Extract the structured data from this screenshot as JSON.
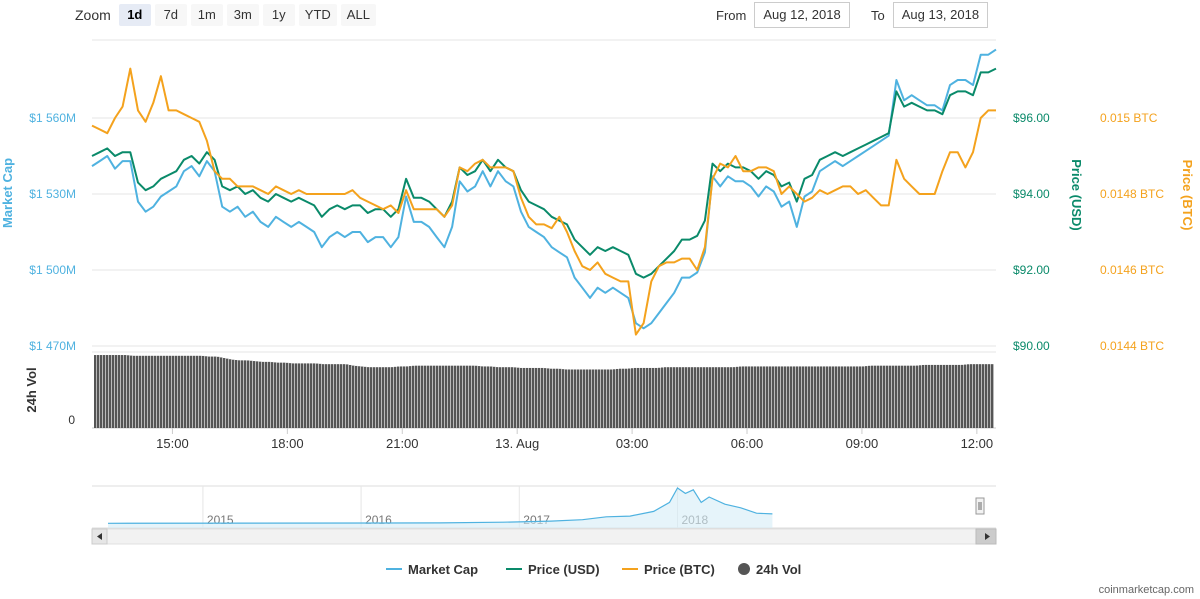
{
  "zoom": {
    "label": "Zoom",
    "buttons": [
      "1d",
      "7d",
      "1m",
      "3m",
      "1y",
      "YTD",
      "ALL"
    ],
    "active": "1d"
  },
  "range": {
    "from_label": "From",
    "from_value": "Aug 12, 2018",
    "to_label": "To",
    "to_value": "Aug 13, 2018"
  },
  "footer": {
    "credit": "coinmarketcap.com"
  },
  "colors": {
    "market_cap": "#4fb2e0",
    "price_usd": "#0a8a6a",
    "price_btc": "#f4a21d",
    "volume": "#555555",
    "grid": "#e6e6e6"
  },
  "chart_data": {
    "type": "line",
    "axes": {
      "left": {
        "title": "Market Cap",
        "ticks": [
          "$1 470M",
          "$1 500M",
          "$1 530M",
          "$1 560M"
        ],
        "range": [
          1470,
          1560
        ],
        "unit": "M USD"
      },
      "right_usd": {
        "title": "Price (USD)",
        "ticks": [
          "$90.00",
          "$92.00",
          "$94.00",
          "$96.00"
        ],
        "range": [
          90,
          96
        ]
      },
      "right_btc": {
        "title": "Price (BTC)",
        "ticks": [
          "0.0144 BTC",
          "0.0146 BTC",
          "0.0148 BTC",
          "0.015 BTC"
        ],
        "range": [
          0.0144,
          0.015
        ]
      },
      "volume": {
        "title": "24h Vol",
        "ticks": [
          "0"
        ]
      },
      "x": {
        "ticks": [
          "15:00",
          "18:00",
          "21:00",
          "13. Aug",
          "03:00",
          "06:00",
          "09:00",
          "12:00"
        ],
        "range_hours": [
          12.9,
          36.5
        ]
      }
    },
    "time_hours": [
      12.9,
      13.1,
      13.3,
      13.5,
      13.7,
      13.9,
      14.1,
      14.3,
      14.5,
      14.7,
      14.9,
      15.1,
      15.3,
      15.5,
      15.7,
      15.9,
      16.1,
      16.3,
      16.5,
      16.7,
      16.9,
      17.1,
      17.3,
      17.5,
      17.7,
      17.9,
      18.1,
      18.3,
      18.5,
      18.7,
      18.9,
      19.1,
      19.3,
      19.5,
      19.7,
      19.9,
      20.1,
      20.3,
      20.5,
      20.7,
      20.9,
      21.1,
      21.3,
      21.5,
      21.7,
      21.9,
      22.1,
      22.3,
      22.5,
      22.7,
      22.9,
      23.1,
      23.3,
      23.5,
      23.7,
      23.9,
      24.1,
      24.3,
      24.5,
      24.7,
      24.9,
      25.1,
      25.3,
      25.5,
      25.7,
      25.9,
      26.1,
      26.3,
      26.5,
      26.7,
      26.9,
      27.1,
      27.3,
      27.5,
      27.7,
      27.9,
      28.1,
      28.3,
      28.5,
      28.7,
      28.9,
      29.1,
      29.3,
      29.5,
      29.7,
      29.9,
      30.1,
      30.3,
      30.5,
      30.7,
      30.9,
      31.1,
      31.3,
      31.5,
      31.7,
      31.9,
      32.1,
      32.3,
      32.5,
      32.7,
      32.9,
      33.1,
      33.3,
      33.5,
      33.7,
      33.9,
      34.1,
      34.3,
      34.5,
      34.7,
      34.9,
      35.1,
      35.3,
      35.5,
      35.7,
      35.9,
      36.1,
      36.3,
      36.5
    ],
    "series": [
      {
        "name": "Price (USD)",
        "axis": "right_usd",
        "values": [
          95.0,
          95.1,
          95.2,
          95.0,
          95.1,
          95.1,
          94.3,
          94.1,
          94.2,
          94.4,
          94.5,
          94.6,
          94.9,
          95.0,
          94.8,
          95.1,
          94.9,
          94.2,
          94.1,
          94.2,
          94.0,
          94.1,
          93.9,
          93.8,
          94.0,
          93.9,
          93.8,
          93.9,
          93.8,
          93.7,
          93.4,
          93.6,
          93.7,
          93.6,
          93.7,
          93.7,
          93.5,
          93.6,
          93.6,
          93.4,
          93.6,
          94.4,
          93.9,
          93.9,
          93.8,
          93.6,
          93.4,
          93.8,
          94.7,
          94.5,
          94.6,
          94.9,
          94.6,
          94.9,
          94.7,
          94.6,
          94.1,
          93.8,
          93.7,
          93.6,
          93.4,
          93.3,
          93.2,
          92.8,
          92.6,
          92.4,
          92.6,
          92.5,
          92.6,
          92.5,
          92.4,
          91.9,
          91.8,
          91.9,
          92.1,
          92.3,
          92.5,
          92.8,
          92.8,
          92.9,
          93.3,
          94.8,
          94.6,
          94.8,
          94.7,
          94.7,
          94.6,
          94.4,
          94.6,
          94.5,
          94.2,
          94.3,
          93.8,
          94.4,
          94.5,
          94.9,
          95.0,
          95.1,
          95.0,
          95.1,
          95.2,
          95.3,
          95.4,
          95.5,
          95.6,
          96.7,
          96.3,
          96.4,
          96.3,
          96.2,
          96.2,
          96.1,
          96.6,
          96.7,
          96.7,
          96.6,
          97.2,
          97.2,
          97.3
        ]
      },
      {
        "name": "Market Cap",
        "axis": "left",
        "values": [
          1541,
          1543,
          1545,
          1540,
          1543,
          1543,
          1527,
          1523,
          1525,
          1529,
          1531,
          1533,
          1539,
          1541,
          1537,
          1543,
          1539,
          1525,
          1523,
          1525,
          1521,
          1523,
          1519,
          1517,
          1521,
          1519,
          1517,
          1519,
          1517,
          1515,
          1509,
          1513,
          1515,
          1513,
          1515,
          1515,
          1511,
          1513,
          1513,
          1509,
          1513,
          1529,
          1519,
          1519,
          1517,
          1513,
          1509,
          1517,
          1535,
          1531,
          1533,
          1539,
          1533,
          1539,
          1535,
          1533,
          1523,
          1517,
          1515,
          1513,
          1509,
          1507,
          1505,
          1497,
          1493,
          1489,
          1493,
          1491,
          1493,
          1491,
          1489,
          1479,
          1477,
          1479,
          1483,
          1487,
          1491,
          1497,
          1497,
          1499,
          1507,
          1537,
          1533,
          1537,
          1535,
          1535,
          1533,
          1529,
          1533,
          1531,
          1525,
          1527,
          1517,
          1529,
          1531,
          1539,
          1541,
          1543,
          1541,
          1543,
          1545,
          1547,
          1549,
          1551,
          1553,
          1575,
          1567,
          1569,
          1567,
          1565,
          1565,
          1563,
          1573,
          1575,
          1575,
          1573,
          1585,
          1585,
          1587
        ]
      },
      {
        "name": "Price (BTC)",
        "axis": "right_btc",
        "values": [
          0.01498,
          0.01497,
          0.01496,
          0.015,
          0.01503,
          0.01513,
          0.01502,
          0.01499,
          0.01504,
          0.01511,
          0.01502,
          0.01502,
          0.01501,
          0.015,
          0.01499,
          0.01494,
          0.01486,
          0.01484,
          0.01484,
          0.01482,
          0.01482,
          0.01482,
          0.01481,
          0.0148,
          0.01482,
          0.01481,
          0.0148,
          0.01481,
          0.0148,
          0.0148,
          0.0148,
          0.0148,
          0.0148,
          0.0148,
          0.01481,
          0.01479,
          0.01478,
          0.01477,
          0.01476,
          0.01477,
          0.01475,
          0.01481,
          0.01476,
          0.01476,
          0.01476,
          0.01476,
          0.01474,
          0.01477,
          0.01487,
          0.01486,
          0.01488,
          0.01489,
          0.01487,
          0.01487,
          0.01487,
          0.01486,
          0.01479,
          0.01474,
          0.01472,
          0.01472,
          0.01471,
          0.01474,
          0.0147,
          0.01465,
          0.01461,
          0.0146,
          0.01462,
          0.01459,
          0.01458,
          0.01457,
          0.01457,
          0.01443,
          0.01446,
          0.01457,
          0.01461,
          0.01462,
          0.01462,
          0.01463,
          0.01463,
          0.0146,
          0.01466,
          0.01484,
          0.01488,
          0.01487,
          0.0149,
          0.01486,
          0.01486,
          0.01487,
          0.01487,
          0.01486,
          0.0148,
          0.01482,
          0.0148,
          0.01478,
          0.01479,
          0.01481,
          0.0148,
          0.01481,
          0.01482,
          0.01482,
          0.0148,
          0.01481,
          0.01479,
          0.01477,
          0.01477,
          0.01489,
          0.01484,
          0.01482,
          0.0148,
          0.0148,
          0.0148,
          0.01486,
          0.01491,
          0.01491,
          0.01487,
          0.01491,
          0.015,
          0.01502,
          0.01502
        ]
      }
    ],
    "volume_relative": [
      0.96,
      0.96,
      0.96,
      0.96,
      0.96,
      0.95,
      0.95,
      0.95,
      0.95,
      0.95,
      0.95,
      0.95,
      0.95,
      0.95,
      0.95,
      0.94,
      0.94,
      0.92,
      0.9,
      0.89,
      0.89,
      0.88,
      0.87,
      0.87,
      0.86,
      0.86,
      0.85,
      0.85,
      0.85,
      0.85,
      0.84,
      0.84,
      0.84,
      0.84,
      0.82,
      0.81,
      0.8,
      0.8,
      0.8,
      0.8,
      0.81,
      0.81,
      0.82,
      0.82,
      0.82,
      0.82,
      0.82,
      0.82,
      0.82,
      0.82,
      0.82,
      0.81,
      0.81,
      0.8,
      0.8,
      0.8,
      0.79,
      0.79,
      0.79,
      0.79,
      0.78,
      0.78,
      0.77,
      0.77,
      0.77,
      0.77,
      0.77,
      0.77,
      0.77,
      0.78,
      0.78,
      0.79,
      0.79,
      0.79,
      0.79,
      0.8,
      0.8,
      0.8,
      0.8,
      0.8,
      0.8,
      0.8,
      0.8,
      0.8,
      0.8,
      0.81,
      0.81,
      0.81,
      0.81,
      0.81,
      0.81,
      0.81,
      0.81,
      0.81,
      0.81,
      0.81,
      0.81,
      0.81,
      0.81,
      0.81,
      0.81,
      0.81,
      0.82,
      0.82,
      0.82,
      0.82,
      0.82,
      0.82,
      0.82,
      0.83,
      0.83,
      0.83,
      0.83,
      0.83,
      0.83,
      0.84,
      0.84,
      0.84,
      0.84
    ],
    "navigator": {
      "year_labels": [
        "2015",
        "2016",
        "2017",
        "2018"
      ],
      "year_positions": [
        2015,
        2016,
        2017,
        2018
      ],
      "range_years": [
        2014.4,
        2019.9
      ],
      "x_years": [
        2014.4,
        2016.5,
        2016.9,
        2017.2,
        2017.4,
        2017.55,
        2017.7,
        2017.85,
        2017.95,
        2018.0,
        2018.05,
        2018.1,
        2018.15,
        2018.2,
        2018.3,
        2018.4,
        2018.5,
        2018.6
      ],
      "values": [
        0.02,
        0.03,
        0.05,
        0.08,
        0.12,
        0.2,
        0.22,
        0.35,
        0.6,
        1.0,
        0.85,
        0.95,
        0.6,
        0.75,
        0.55,
        0.45,
        0.3,
        0.28
      ],
      "max_value": 1.0
    },
    "legend": [
      "Market Cap",
      "Price (USD)",
      "Price (BTC)",
      "24h Vol"
    ],
    "grid": true
  }
}
